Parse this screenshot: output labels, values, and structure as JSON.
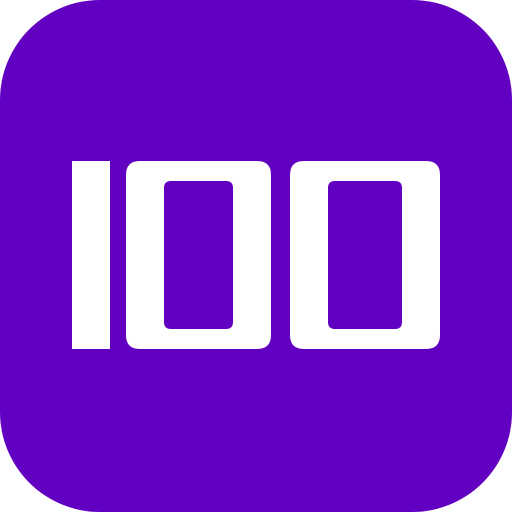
{
  "icon": {
    "name": "100-app-icon",
    "text": "100",
    "background_color": "#6200C2",
    "foreground_color": "#FFFFFF"
  }
}
